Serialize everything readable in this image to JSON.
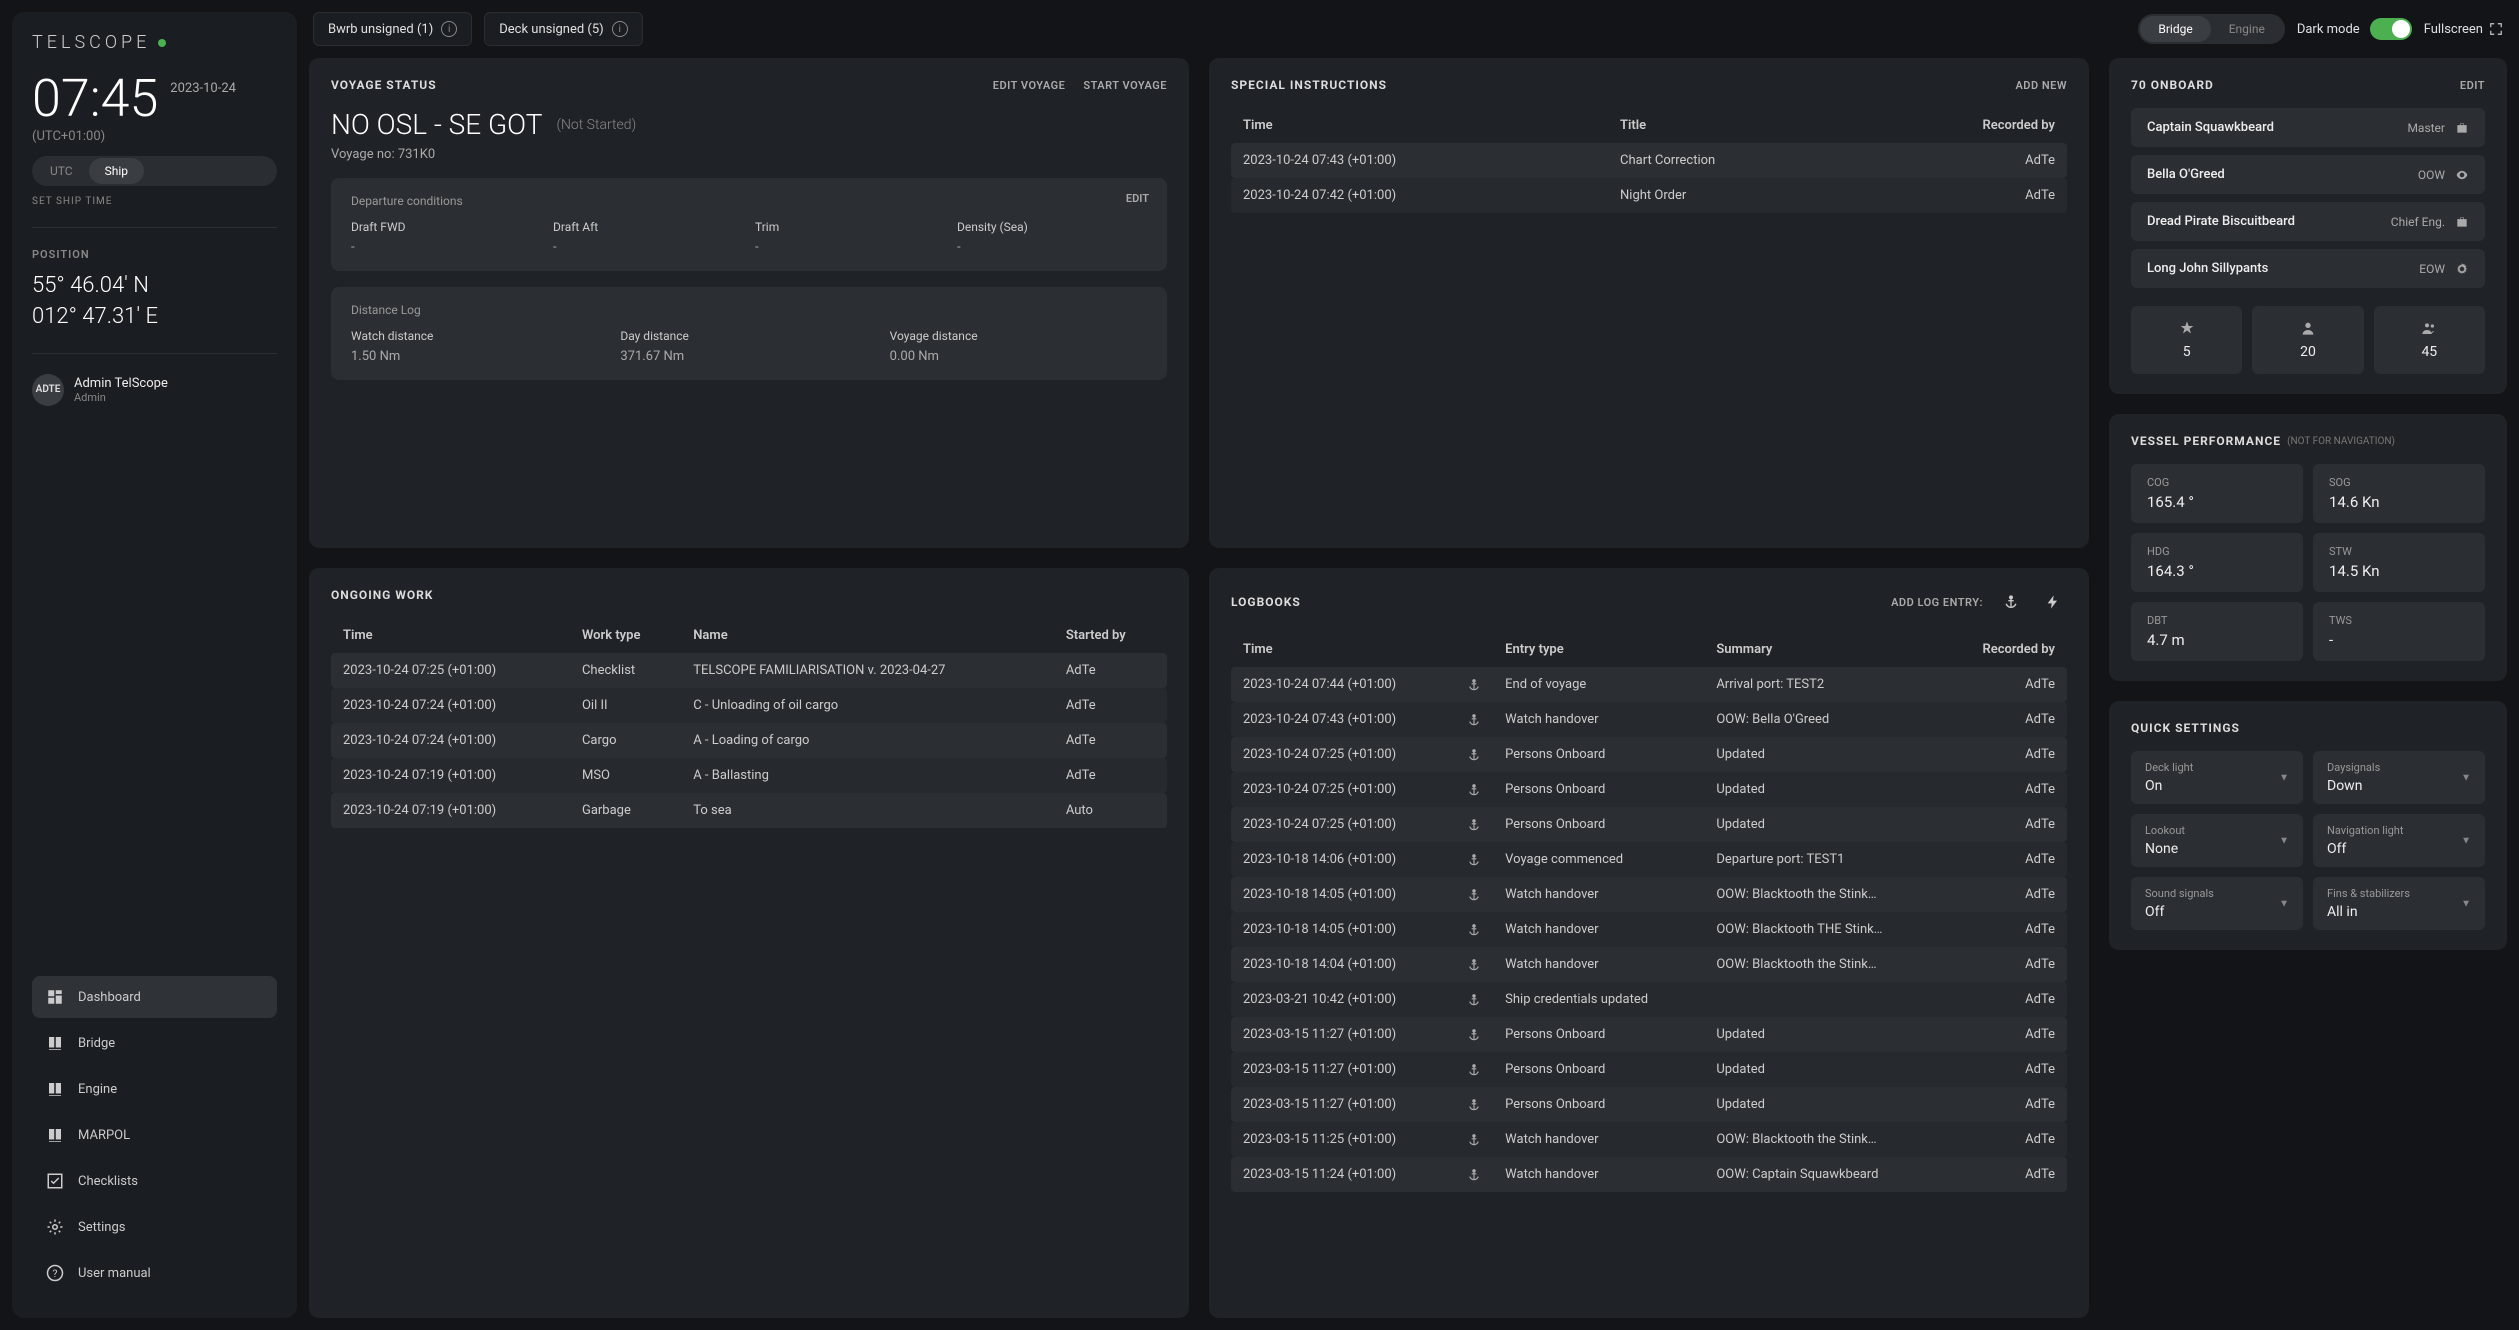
{
  "brand": "TELSCOPE",
  "clock": {
    "time": "07:45",
    "date": "2023-10-24",
    "tz": "(UTC+01:00)",
    "utc": "UTC",
    "ship": "Ship",
    "set": "SET SHIP TIME"
  },
  "position": {
    "label": "POSITION",
    "lat": "55° 46.04' N",
    "lon": "012° 47.31' E"
  },
  "user": {
    "initials": "ADTE",
    "name": "Admin TelScope",
    "role": "Admin"
  },
  "nav": {
    "dashboard": "Dashboard",
    "bridge": "Bridge",
    "engine": "Engine",
    "marpol": "MARPOL",
    "checklists": "Checklists",
    "settings": "Settings",
    "manual": "User manual"
  },
  "topbar": {
    "bwrb": "Bwrb unsigned (1)",
    "deck": "Deck unsigned (5)",
    "bridge": "Bridge",
    "engine": "Engine",
    "dark": "Dark mode",
    "fullscreen": "Fullscreen"
  },
  "voyage": {
    "header": "VOYAGE STATUS",
    "edit": "EDIT VOYAGE",
    "start": "START VOYAGE",
    "title": "NO OSL - SE GOT",
    "status": "(Not Started)",
    "no": "Voyage no: 731K0",
    "dep": {
      "label": "Departure conditions",
      "edit": "EDIT",
      "draft_fwd_l": "Draft FWD",
      "draft_fwd_v": "-",
      "draft_aft_l": "Draft Aft",
      "draft_aft_v": "-",
      "trim_l": "Trim",
      "trim_v": "-",
      "density_l": "Density (Sea)",
      "density_v": "-"
    },
    "dist": {
      "label": "Distance Log",
      "watch_l": "Watch distance",
      "watch_v": "1.50 Nm",
      "day_l": "Day distance",
      "day_v": "371.67 Nm",
      "voy_l": "Voyage distance",
      "voy_v": "0.00 Nm"
    }
  },
  "special": {
    "header": "SPECIAL INSTRUCTIONS",
    "add": "ADD NEW",
    "cols": {
      "time": "Time",
      "title": "Title",
      "rec": "Recorded by"
    },
    "rows": [
      {
        "time": "2023-10-24 07:43 (+01:00)",
        "title": "Chart Correction",
        "rec": "AdTe"
      },
      {
        "time": "2023-10-24 07:42 (+01:00)",
        "title": "Night Order",
        "rec": "AdTe"
      }
    ]
  },
  "onboard": {
    "header": "70 ONBOARD",
    "edit": "EDIT",
    "crew": [
      {
        "name": "Captain Squawkbeard",
        "role": "Master",
        "icon": "case"
      },
      {
        "name": "Bella O'Greed",
        "role": "OOW",
        "icon": "eye"
      },
      {
        "name": "Dread Pirate Biscuitbeard",
        "role": "Chief Eng.",
        "icon": "case"
      },
      {
        "name": "Long John Sillypants",
        "role": "EOW",
        "icon": "gear"
      }
    ],
    "stats": [
      {
        "v": "5"
      },
      {
        "v": "20"
      },
      {
        "v": "45"
      }
    ]
  },
  "ongoing": {
    "header": "ONGOING WORK",
    "cols": {
      "time": "Time",
      "type": "Work type",
      "name": "Name",
      "by": "Started by"
    },
    "rows": [
      {
        "time": "2023-10-24 07:25 (+01:00)",
        "type": "Checklist",
        "name": "TELSCOPE FAMILIARISATION v. 2023-04-27",
        "by": "AdTe"
      },
      {
        "time": "2023-10-24 07:24 (+01:00)",
        "type": "Oil II",
        "name": "C - Unloading of oil cargo",
        "by": "AdTe"
      },
      {
        "time": "2023-10-24 07:24 (+01:00)",
        "type": "Cargo",
        "name": "A - Loading of cargo",
        "by": "AdTe"
      },
      {
        "time": "2023-10-24 07:19 (+01:00)",
        "type": "MSO",
        "name": "A - Ballasting",
        "by": "AdTe"
      },
      {
        "time": "2023-10-24 07:19 (+01:00)",
        "type": "Garbage",
        "name": "To sea",
        "by": "Auto"
      }
    ]
  },
  "logbooks": {
    "header": "LOGBOOKS",
    "add": "ADD LOG ENTRY:",
    "cols": {
      "time": "Time",
      "type": "Entry type",
      "sum": "Summary",
      "rec": "Recorded by"
    },
    "rows": [
      {
        "time": "2023-10-24 07:44 (+01:00)",
        "type": "End of voyage",
        "sum": "Arrival port: TEST2",
        "rec": "AdTe"
      },
      {
        "time": "2023-10-24 07:43 (+01:00)",
        "type": "Watch handover",
        "sum": "OOW: Bella O'Greed",
        "rec": "AdTe"
      },
      {
        "time": "2023-10-24 07:25 (+01:00)",
        "type": "Persons Onboard",
        "sum": "Updated",
        "rec": "AdTe"
      },
      {
        "time": "2023-10-24 07:25 (+01:00)",
        "type": "Persons Onboard",
        "sum": "Updated",
        "rec": "AdTe"
      },
      {
        "time": "2023-10-24 07:25 (+01:00)",
        "type": "Persons Onboard",
        "sum": "Updated",
        "rec": "AdTe"
      },
      {
        "time": "2023-10-18 14:06 (+01:00)",
        "type": "Voyage commenced",
        "sum": "Departure port: TEST1",
        "rec": "AdTe"
      },
      {
        "time": "2023-10-18 14:05 (+01:00)",
        "type": "Watch handover",
        "sum": "OOW: Blacktooth the Stink…",
        "rec": "AdTe"
      },
      {
        "time": "2023-10-18 14:05 (+01:00)",
        "type": "Watch handover",
        "sum": "OOW: Blacktooth THE Stink…",
        "rec": "AdTe"
      },
      {
        "time": "2023-10-18 14:04 (+01:00)",
        "type": "Watch handover",
        "sum": "OOW: Blacktooth the Stink…",
        "rec": "AdTe"
      },
      {
        "time": "2023-03-21 10:42 (+01:00)",
        "type": "Ship credentials updated",
        "sum": "",
        "rec": "AdTe"
      },
      {
        "time": "2023-03-15 11:27 (+01:00)",
        "type": "Persons Onboard",
        "sum": "Updated",
        "rec": "AdTe"
      },
      {
        "time": "2023-03-15 11:27 (+01:00)",
        "type": "Persons Onboard",
        "sum": "Updated",
        "rec": "AdTe"
      },
      {
        "time": "2023-03-15 11:27 (+01:00)",
        "type": "Persons Onboard",
        "sum": "Updated",
        "rec": "AdTe"
      },
      {
        "time": "2023-03-15 11:25 (+01:00)",
        "type": "Watch handover",
        "sum": "OOW: Blacktooth the Stink…",
        "rec": "AdTe"
      },
      {
        "time": "2023-03-15 11:24 (+01:00)",
        "type": "Watch handover",
        "sum": "OOW: Captain Squawkbeard",
        "rec": "AdTe"
      }
    ]
  },
  "perf": {
    "header": "VESSEL PERFORMANCE",
    "sub": "(NOT FOR NAVIGATION)",
    "items": [
      {
        "l": "COG",
        "v": "165.4 °"
      },
      {
        "l": "SOG",
        "v": "14.6 Kn"
      },
      {
        "l": "HDG",
        "v": "164.3 °"
      },
      {
        "l": "STW",
        "v": "14.5 Kn"
      },
      {
        "l": "DBT",
        "v": "4.7 m"
      },
      {
        "l": "TWS",
        "v": "-"
      }
    ]
  },
  "qs": {
    "header": "QUICK SETTINGS",
    "items": [
      {
        "l": "Deck light",
        "v": "On"
      },
      {
        "l": "Daysignals",
        "v": "Down"
      },
      {
        "l": "Lookout",
        "v": "None"
      },
      {
        "l": "Navigation light",
        "v": "Off"
      },
      {
        "l": "Sound signals",
        "v": "Off"
      },
      {
        "l": "Fins & stabilizers",
        "v": "All in"
      }
    ]
  }
}
